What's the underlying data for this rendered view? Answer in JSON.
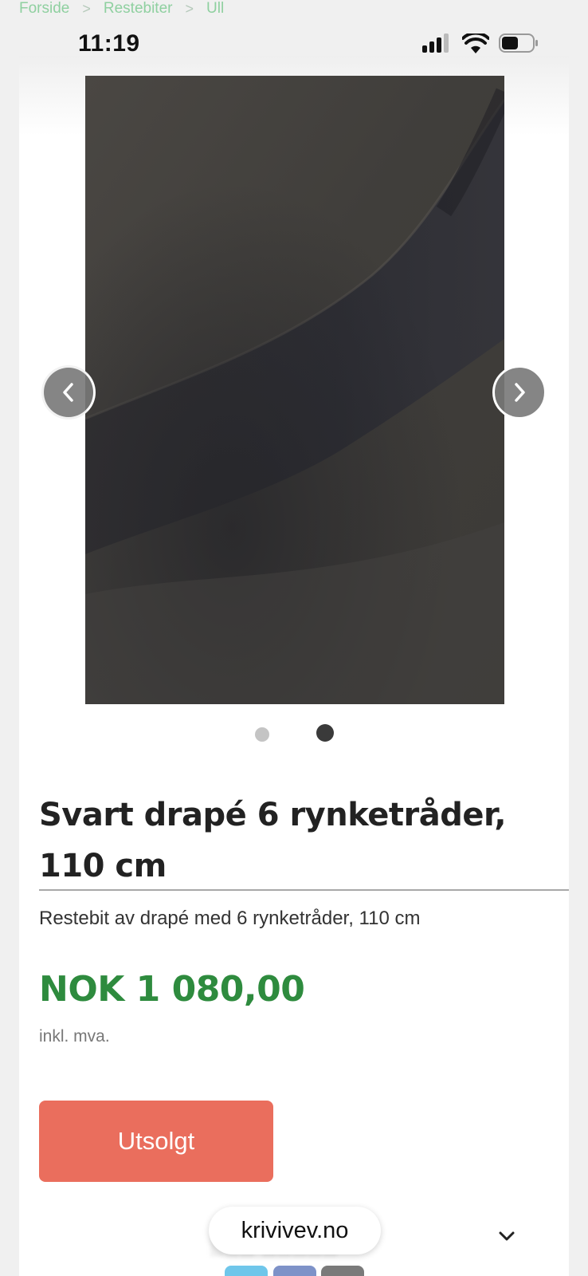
{
  "breadcrumb": {
    "items": [
      "Forside",
      "Restebiter",
      "Ull"
    ],
    "separator": ">"
  },
  "status_bar": {
    "time": "11:19",
    "signal_bars": 3,
    "battery_level": 0.5
  },
  "product": {
    "title": "Svart drapé 6 rynketråder, 110 cm",
    "description": "Restebit av drapé med 6 rynketråder, 110 cm",
    "price": "NOK 1 080,00",
    "vat_note": "inkl. mva.",
    "button_label": "Utsolgt",
    "image_alt": "Svart drapé stoff",
    "carousel": {
      "total_images": 2,
      "active_index": 1
    }
  },
  "colors": {
    "price": "#2e8b3e",
    "button": "#ea6e5d",
    "breadcrumb": "#8fd0a0"
  },
  "browser": {
    "url": "krivivev.no"
  }
}
